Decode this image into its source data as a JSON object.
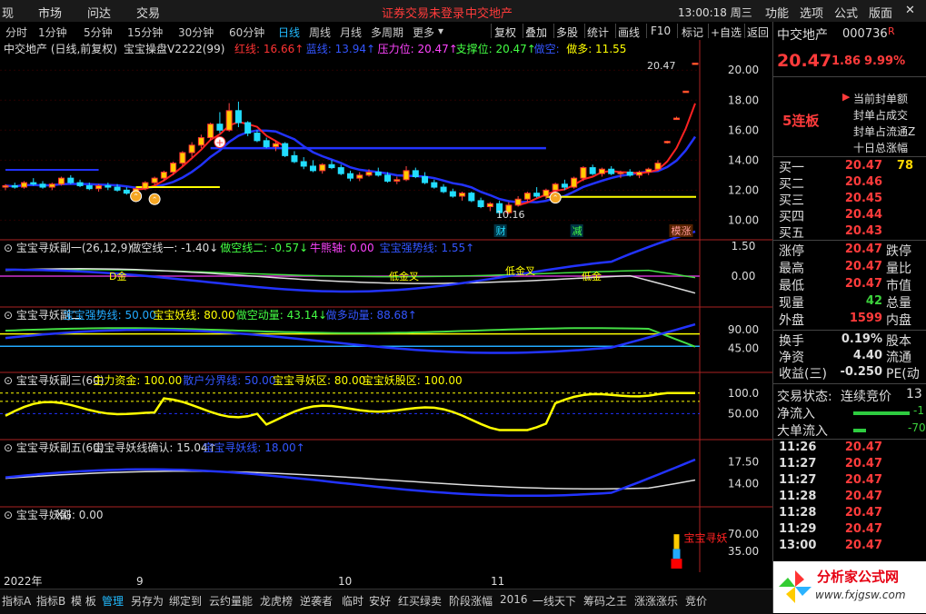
{
  "menubar": {
    "items": [
      "现",
      "市场",
      "问达",
      "交易"
    ],
    "status": "证券交易未登录",
    "stock": "中交地产",
    "clock": "13:00:18 周三",
    "right_items": [
      "功能",
      "选项",
      "公式",
      "版面"
    ]
  },
  "timeframes": [
    "分时",
    "1分钟",
    "5分钟",
    "15分钟",
    "30分钟",
    "60分钟",
    "日线",
    "周线",
    "月线",
    "多周期",
    "更多"
  ],
  "active_timeframe": "日线",
  "toolbar_right": [
    "复权",
    "叠加",
    "多股",
    "统计",
    "画线",
    "F10",
    "标记",
    "+自选",
    "返回"
  ],
  "main_panel": {
    "title": "中交地产 (日线,前复权)",
    "indicator": "宝宝操盘V2222(99)",
    "legend": [
      {
        "label": "红线: 16.66",
        "color": "#ff3333",
        "arrow": "↑"
      },
      {
        "label": "蓝线: 13.94",
        "color": "#3355ff",
        "arrow": "↑"
      },
      {
        "label": "压力位: 20.47",
        "color": "#ff44ff",
        "arrow": "↑"
      },
      {
        "label": "支撑位: 20.47",
        "color": "#44ff44",
        "arrow": "↑"
      },
      {
        "label": "做空:",
        "color": "#3355ff",
        "arrow": ""
      },
      {
        "label": "做多: 11.55",
        "color": "#ffff00",
        "arrow": ""
      }
    ],
    "high_label": "20.47",
    "low_label": "10.16",
    "events": [
      "财",
      "减",
      "模涨"
    ],
    "price_ticks": [
      "20.00",
      "18.00",
      "16.00",
      "14.00",
      "12.00",
      "10.00"
    ]
  },
  "sub1": {
    "title": "宝宝寻妖副一(26,12,9)",
    "legend": [
      {
        "label": "做空线一: -1.40↓",
        "color": "#dddddd"
      },
      {
        "label": "做空线二: -0.57↓",
        "color": "#44ff44"
      },
      {
        "label": "牛熊轴: 0.00",
        "color": "#ff44ff"
      },
      {
        "label": "宝宝强势线: 1.55↑",
        "color": "#3355ff"
      }
    ],
    "ticks": [
      "1.50",
      "0.00"
    ],
    "annotations": [
      "D金",
      "低金叉",
      "低金叉",
      "低金"
    ]
  },
  "sub2": {
    "title": "宝宝寻妖副二",
    "legend": [
      {
        "label": "宝宝强势线: 50.00",
        "color": "#22aaff"
      },
      {
        "label": "宝宝妖线: 80.00",
        "color": "#ffff00"
      },
      {
        "label": "做空动量: 43.14↓",
        "color": "#44ff44"
      },
      {
        "label": "做多动量: 88.68↑",
        "color": "#3355ff"
      }
    ],
    "ticks": [
      "90.00",
      "45.00"
    ]
  },
  "sub3": {
    "title": "宝宝寻妖副三(60)",
    "legend": [
      {
        "label": "主力资金: 100.00",
        "color": "#ffff00"
      },
      {
        "label": "散户分界线: 50.00",
        "color": "#3355ff"
      },
      {
        "label": "宝宝寻妖区: 80.00",
        "color": "#ffff00"
      },
      {
        "label": "宝宝妖股区: 100.00",
        "color": "#ffff00"
      }
    ],
    "ticks": [
      "100.0",
      "50.00"
    ]
  },
  "sub4": {
    "title": "宝宝寻妖副五(60)",
    "legend": [
      {
        "label": "宝宝寻妖线确认: 15.04↑",
        "color": "#dddddd"
      },
      {
        "label": "宝宝寻妖线: 18.00↑",
        "color": "#3355ff"
      }
    ],
    "ticks": [
      "17.50",
      "14.00"
    ]
  },
  "sub5": {
    "title": "宝宝寻妖副",
    "legend": [
      {
        "label": "XG: 0.00",
        "color": "#dddddd"
      }
    ],
    "ticks": [
      "70.00",
      "35.00"
    ],
    "signal_label": "宝宝寻妖"
  },
  "x_axis": [
    "2022年",
    "9",
    "10",
    "11"
  ],
  "right_panel": {
    "name": "中交地产",
    "code": "000736",
    "flag": "R",
    "price": "20.47",
    "change": "1.86",
    "pct": "9.99%",
    "limit_items": [
      "当前封单额",
      "封单占成交",
      "封单占流通Z",
      "十日总涨幅"
    ],
    "streak": "5连板",
    "bids": [
      {
        "label": "买一",
        "price": "20.47",
        "vol": "78"
      },
      {
        "label": "买二",
        "price": "20.46",
        "vol": ""
      },
      {
        "label": "买三",
        "price": "20.45",
        "vol": ""
      },
      {
        "label": "买四",
        "price": "20.44",
        "vol": ""
      },
      {
        "label": "买五",
        "price": "20.43",
        "vol": ""
      }
    ],
    "stats": [
      {
        "label": "涨停",
        "val": "20.47",
        "label2": "跌停",
        "cls": "red"
      },
      {
        "label": "最高",
        "val": "20.47",
        "label2": "量比",
        "cls": "red"
      },
      {
        "label": "最低",
        "val": "20.47",
        "label2": "市值",
        "cls": "red"
      },
      {
        "label": "现量",
        "val": "42",
        "label2": "总量",
        "cls": "green"
      },
      {
        "label": "外盘",
        "val": "1599",
        "label2": "内盘",
        "cls": "red"
      }
    ],
    "stats2": [
      {
        "label": "换手",
        "val": "0.19%",
        "label2": "股本"
      },
      {
        "label": "净资",
        "val": "4.40",
        "label2": "流通"
      },
      {
        "label": "收益(三)",
        "val": "-0.250",
        "label2": "PE(动"
      }
    ],
    "trade_state_label": "交易状态:",
    "trade_state": "连续竞价",
    "trade_state_extra": "13",
    "net_in_label": "净流入",
    "net_in_val": "-1",
    "big_in_label": "大单流入",
    "big_in_val": "-70",
    "ticks": [
      {
        "time": "11:26",
        "price": "20.47"
      },
      {
        "time": "11:27",
        "price": "20.47"
      },
      {
        "time": "11:27",
        "price": "20.47"
      },
      {
        "time": "11:28",
        "price": "20.47"
      },
      {
        "time": "11:28",
        "price": "20.47"
      },
      {
        "time": "11:29",
        "price": "20.47"
      },
      {
        "time": "13:00",
        "price": "20.47"
      }
    ],
    "logo_text": "分析家公式网",
    "logo_url": "www.fxjgsw.com"
  },
  "bottom_tabs": [
    "指标A",
    "指标B",
    "模 板",
    "管理",
    "另存为",
    "绑定到",
    "云约量能",
    "龙虎榜",
    "逆袭者",
    "临时",
    "安好",
    "红买绿卖",
    "阶段涨幅",
    "2016",
    "一线天下",
    "筹码之王",
    "涨涨涨乐",
    "竞价"
  ],
  "active_bottom_tab": "管理",
  "chart_data": {
    "type": "candlestick",
    "candles": [
      [
        12.2,
        12.4,
        12.0,
        12.3
      ],
      [
        12.3,
        12.5,
        12.1,
        12.2
      ],
      [
        12.2,
        12.6,
        12.1,
        12.5
      ],
      [
        12.5,
        12.8,
        12.3,
        12.4
      ],
      [
        12.4,
        12.6,
        12.1,
        12.2
      ],
      [
        12.2,
        12.5,
        12.0,
        12.4
      ],
      [
        12.4,
        12.9,
        12.3,
        12.8
      ],
      [
        12.8,
        13.0,
        12.4,
        12.5
      ],
      [
        12.5,
        12.7,
        12.2,
        12.3
      ],
      [
        12.3,
        12.5,
        12.0,
        12.1
      ],
      [
        12.1,
        12.4,
        11.9,
        12.3
      ],
      [
        12.3,
        12.5,
        12.0,
        12.2
      ],
      [
        12.2,
        12.4,
        11.9,
        12.0
      ],
      [
        12.0,
        12.2,
        11.7,
        11.8
      ],
      [
        11.8,
        12.2,
        11.7,
        12.1
      ],
      [
        12.1,
        12.6,
        12.0,
        12.5
      ],
      [
        12.5,
        12.9,
        12.3,
        12.8
      ],
      [
        12.8,
        13.3,
        12.6,
        13.2
      ],
      [
        13.2,
        13.9,
        13.0,
        13.8
      ],
      [
        13.8,
        14.6,
        13.6,
        14.5
      ],
      [
        14.5,
        15.2,
        14.2,
        15.0
      ],
      [
        15.0,
        15.7,
        14.8,
        15.5
      ],
      [
        15.5,
        16.5,
        15.3,
        16.4
      ],
      [
        16.4,
        17.2,
        15.8,
        16.0
      ],
      [
        16.0,
        17.8,
        15.9,
        17.3
      ],
      [
        17.3,
        17.9,
        16.2,
        16.5
      ],
      [
        16.5,
        16.6,
        15.6,
        15.8
      ],
      [
        15.8,
        16.0,
        15.2,
        15.3
      ],
      [
        15.3,
        15.5,
        14.8,
        14.9
      ],
      [
        14.9,
        15.3,
        14.6,
        15.1
      ],
      [
        15.1,
        15.2,
        14.2,
        14.3
      ],
      [
        14.3,
        14.6,
        13.8,
        13.9
      ],
      [
        13.9,
        14.2,
        13.4,
        13.6
      ],
      [
        13.6,
        14.0,
        13.2,
        13.3
      ],
      [
        13.3,
        13.8,
        13.1,
        13.7
      ],
      [
        13.7,
        14.0,
        13.4,
        13.5
      ],
      [
        13.5,
        13.7,
        13.0,
        13.1
      ],
      [
        13.1,
        13.3,
        12.6,
        12.8
      ],
      [
        12.8,
        13.2,
        12.6,
        13.0
      ],
      [
        13.0,
        13.4,
        12.9,
        13.2
      ],
      [
        13.2,
        13.5,
        12.9,
        13.0
      ],
      [
        13.0,
        13.2,
        12.5,
        12.6
      ],
      [
        12.6,
        12.9,
        12.4,
        12.7
      ],
      [
        12.7,
        13.6,
        12.6,
        13.3
      ],
      [
        13.3,
        13.5,
        12.8,
        12.9
      ],
      [
        12.9,
        13.2,
        12.4,
        12.5
      ],
      [
        12.5,
        12.7,
        12.1,
        12.2
      ],
      [
        12.2,
        12.4,
        11.8,
        11.9
      ],
      [
        11.9,
        12.1,
        11.5,
        11.6
      ],
      [
        11.6,
        11.9,
        11.3,
        11.8
      ],
      [
        11.8,
        11.9,
        11.2,
        11.3
      ],
      [
        11.3,
        11.5,
        10.8,
        10.9
      ],
      [
        10.9,
        11.2,
        10.6,
        11.1
      ],
      [
        11.1,
        11.3,
        10.16,
        10.5
      ],
      [
        10.5,
        11.2,
        10.4,
        11.0
      ],
      [
        11.0,
        11.6,
        10.9,
        11.4
      ],
      [
        11.4,
        11.9,
        11.2,
        11.8
      ],
      [
        11.8,
        12.2,
        11.5,
        11.6
      ],
      [
        11.6,
        12.1,
        11.4,
        12.0
      ],
      [
        12.0,
        12.5,
        11.8,
        12.4
      ],
      [
        12.4,
        12.7,
        12.0,
        12.2
      ],
      [
        12.2,
        12.9,
        12.1,
        12.8
      ],
      [
        12.8,
        13.6,
        12.6,
        13.5
      ],
      [
        13.5,
        13.7,
        13.0,
        13.1
      ],
      [
        13.1,
        13.5,
        12.9,
        13.4
      ],
      [
        13.4,
        13.6,
        13.0,
        13.1
      ],
      [
        13.1,
        13.3,
        12.8,
        13.2
      ],
      [
        13.2,
        13.4,
        12.9,
        13.0
      ],
      [
        13.0,
        13.3,
        12.8,
        13.2
      ],
      [
        13.2,
        13.5,
        13.0,
        13.4
      ],
      [
        13.4,
        14.0,
        13.3,
        13.8
      ],
      [
        15.2,
        15.3,
        15.1,
        15.25
      ],
      [
        16.8,
        16.9,
        16.7,
        16.8
      ],
      [
        18.6,
        18.6,
        18.6,
        18.6
      ],
      [
        20.47,
        20.47,
        20.47,
        20.47
      ]
    ]
  }
}
